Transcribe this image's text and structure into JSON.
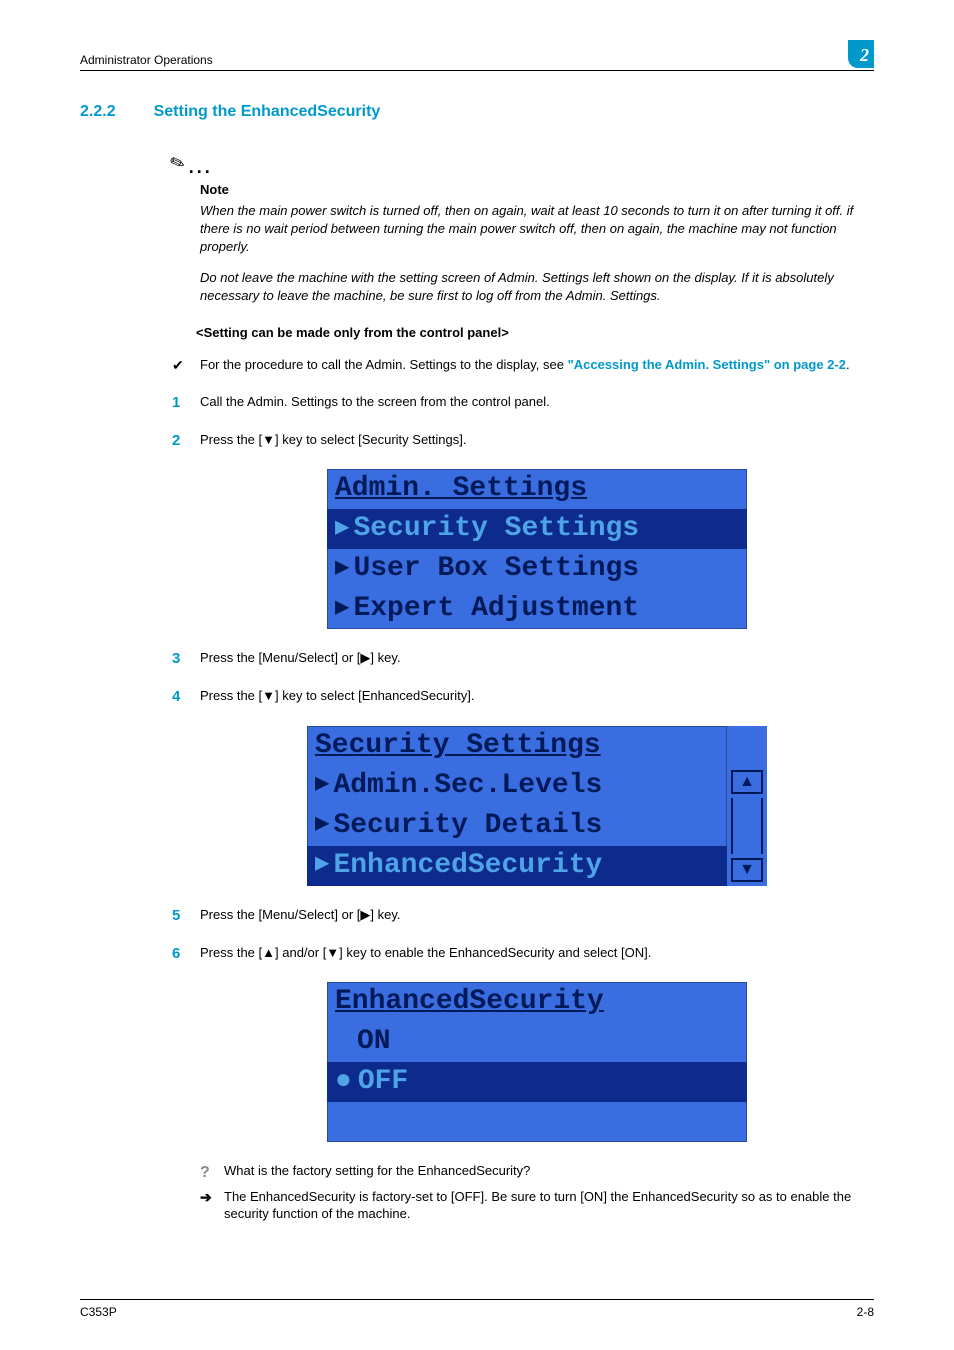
{
  "running_head": "Administrator Operations",
  "chapter_num": "2",
  "section": {
    "number": "2.2.2",
    "title": "Setting the EnhancedSecurity"
  },
  "note": {
    "label": "Note",
    "p1": "When the main power switch is turned off, then on again, wait at least 10 seconds to turn it on after turning it off. if there is no wait period between turning the main power switch off, then on again, the machine may not function properly.",
    "p2": "Do not leave the machine with the setting screen of Admin. Settings left shown on the display. If it is absolutely necessary to leave the machine, be sure first to log off from the Admin. Settings."
  },
  "sub_head": "<Setting can be made only from the control panel>",
  "proc_ref": {
    "pre": "For the procedure to call the Admin. Settings to the display, see ",
    "link": "\"Accessing the Admin. Settings\" on page 2-2",
    "post": "."
  },
  "steps": {
    "s1": "Call the Admin. Settings to the screen from the control panel.",
    "s2": "Press the [▼] key to select [Security Settings].",
    "s3": "Press the [Menu/Select] or [▶] key.",
    "s4": "Press the [▼] key to select [EnhancedSecurity].",
    "s5": "Press the [Menu/Select] or [▶] key.",
    "s6": "Press the [▲] and/or [▼] key to enable the EnhancedSecurity and select [ON]."
  },
  "lcd1": {
    "title": "Admin. Settings",
    "r1": "Security Settings",
    "r2": "User Box Settings",
    "r3": "Expert Adjustment"
  },
  "lcd2": {
    "title": "Security Settings",
    "r1": "Admin.Sec.Levels",
    "r2": "Security Details",
    "r3": "EnhancedSecurity"
  },
  "lcd3": {
    "title": "EnhancedSecurity",
    "r1": "ON",
    "r2": "OFF"
  },
  "qa": {
    "q": "What is the factory setting for the EnhancedSecurity?",
    "a": "The EnhancedSecurity is factory-set to [OFF]. Be sure to turn [ON] the EnhancedSecurity so as to enable the security function of the machine."
  },
  "footer": {
    "left": "C353P",
    "right": "2-8"
  }
}
